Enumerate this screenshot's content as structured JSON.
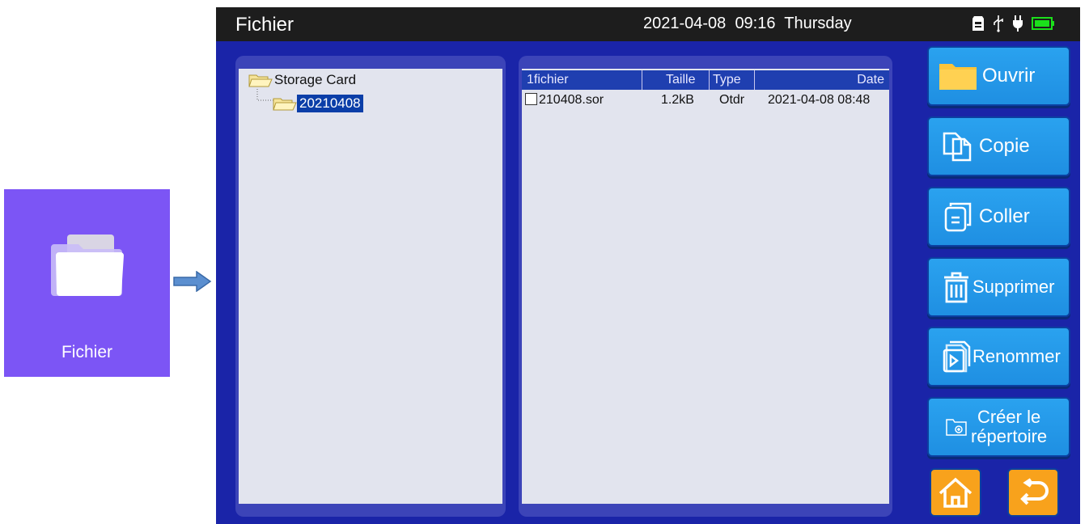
{
  "app_tile": {
    "label": "Fichier",
    "icon": "folder-icon",
    "color": "#7c55f5"
  },
  "topbar": {
    "title": "Fichier",
    "date": "2021-04-08",
    "time": "09:16",
    "weekday": "Thursday",
    "icons": [
      "sd-card-icon",
      "usb-icon",
      "power-plug-icon",
      "battery-icon"
    ]
  },
  "tree": {
    "root": "Storage Card",
    "child": "20210408"
  },
  "files": {
    "columns": [
      "1fichier",
      "Taille",
      "Type",
      "Date"
    ],
    "rows": [
      {
        "name": "210408.sor",
        "size": "1.2kB",
        "type": "Otdr",
        "date": "2021-04-08 08:48"
      }
    ]
  },
  "actions": {
    "open": "Ouvrir",
    "copy": "Copie",
    "paste": "Coller",
    "delete": "Supprimer",
    "rename": "Renommer",
    "mkdir_line1": "Créer le",
    "mkdir_line2": "répertoire"
  },
  "nav": {
    "home_icon": "home-icon",
    "back_icon": "back-icon"
  },
  "colors": {
    "screen_bg": "#1a24a8",
    "button": "#2196e8",
    "nav_button": "#f8a21c",
    "selection": "#0b3ea8"
  }
}
